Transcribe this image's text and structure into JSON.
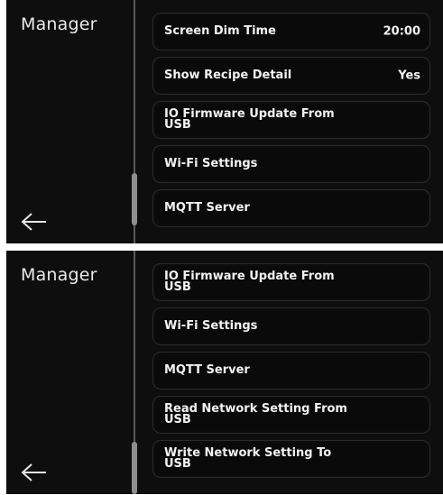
{
  "screens": [
    {
      "title": "Manager",
      "items": [
        {
          "label": "Screen Dim Time",
          "value": "20:00"
        },
        {
          "label": "Show Recipe Detail",
          "value": "Yes"
        },
        {
          "label": "IO Firmware Update From USB",
          "value": ""
        },
        {
          "label": "Wi-Fi Settings",
          "value": ""
        },
        {
          "label": "MQTT Server",
          "value": ""
        }
      ],
      "back_icon": "left-arrow-icon"
    },
    {
      "title": "Manager",
      "items": [
        {
          "label": "IO Firmware Update From USB",
          "value": ""
        },
        {
          "label": "Wi-Fi Settings",
          "value": ""
        },
        {
          "label": "MQTT Server",
          "value": ""
        },
        {
          "label": "Read Network Setting From USB",
          "value": ""
        },
        {
          "label": "Write Network Setting To USB",
          "value": ""
        }
      ],
      "back_icon": "left-arrow-icon"
    }
  ]
}
